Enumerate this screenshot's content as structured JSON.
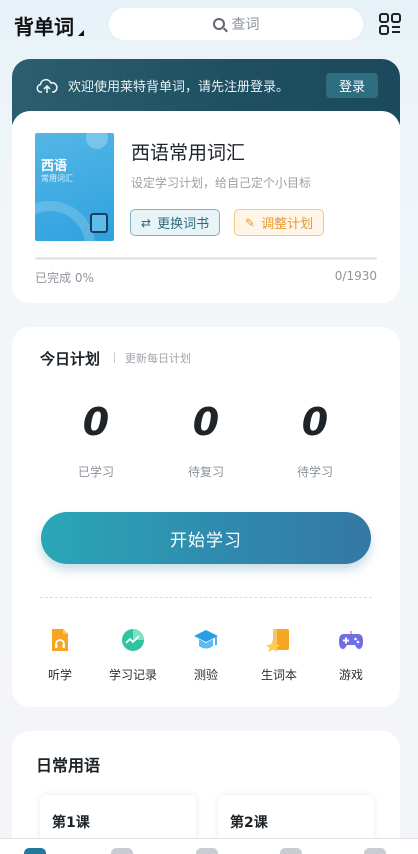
{
  "header": {
    "title": "背单词",
    "search_placeholder": "查词"
  },
  "banner": {
    "message": "欢迎使用莱特背单词，请先注册登录。",
    "login_label": "登录"
  },
  "book": {
    "cover_lang": "西语",
    "cover_sub": "常用词汇",
    "title": "西语常用词汇",
    "desc": "设定学习计划，给自己定个小目标",
    "switch_label": "更换词书",
    "plan_label": "调整计划",
    "progress_fraction": 0,
    "completed_label": "已完成 0%",
    "count_label": "0/1930"
  },
  "today": {
    "title": "今日计划",
    "subtitle": "更新每日计划",
    "stats": [
      {
        "value": "0",
        "label": "已学习"
      },
      {
        "value": "0",
        "label": "待复习"
      },
      {
        "value": "0",
        "label": "待学习"
      }
    ],
    "start_label": "开始学习",
    "tools": [
      {
        "label": "听学",
        "icon": "headphones-doc-icon",
        "color": "#f5a623"
      },
      {
        "label": "学习记录",
        "icon": "chart-icon",
        "color": "#2ec4a0"
      },
      {
        "label": "测验",
        "icon": "graduation-cap-icon",
        "color": "#2a9fe6"
      },
      {
        "label": "生词本",
        "icon": "star-book-icon",
        "color": "#f5a623"
      },
      {
        "label": "游戏",
        "icon": "gamepad-icon",
        "color": "#6f6ee8"
      }
    ]
  },
  "daily": {
    "title": "日常用语",
    "lessons": [
      "第1课",
      "第2课"
    ]
  },
  "colors": {
    "accent": "#2a7b90",
    "banner_bg": "#1e4f61",
    "orange": "#e59a3a"
  }
}
